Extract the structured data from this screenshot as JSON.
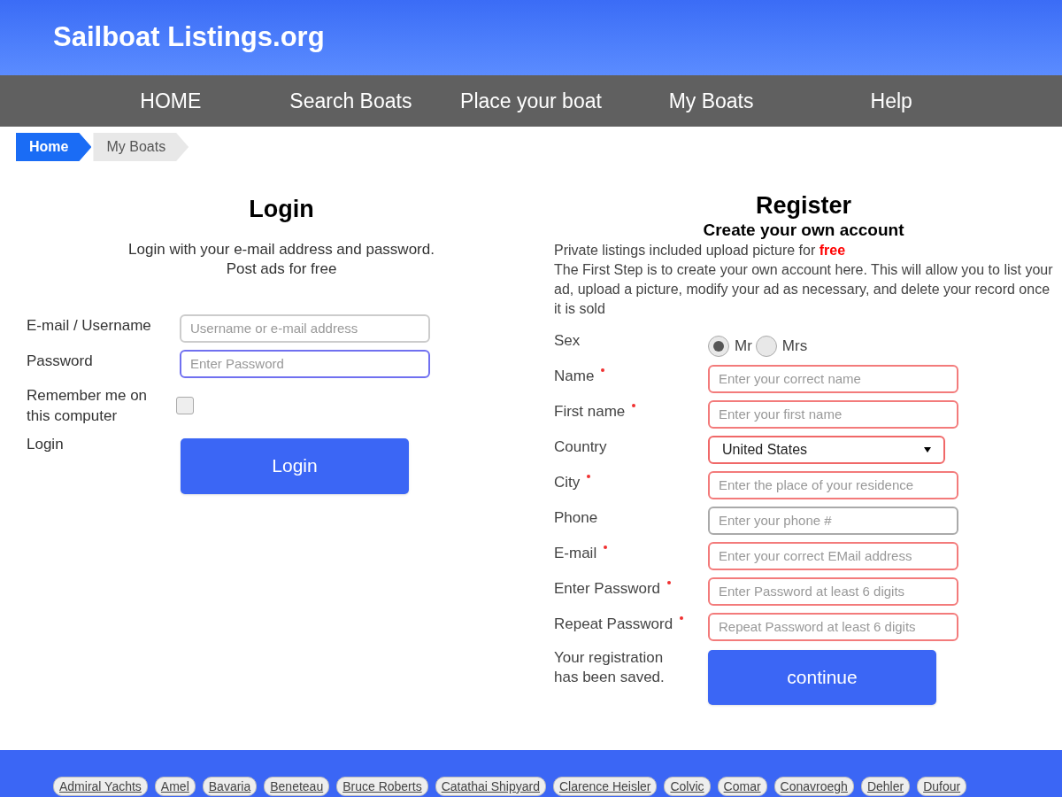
{
  "site_title": "Sailboat Listings.org",
  "nav": [
    "HOME",
    "Search Boats",
    "Place your boat",
    "My Boats",
    "Help"
  ],
  "breadcrumb": [
    {
      "label": "Home",
      "selected": true
    },
    {
      "label": "My Boats",
      "selected": false
    }
  ],
  "login": {
    "title": "Login",
    "intro": [
      "Login with your e-mail address and password.",
      "Post ads for free"
    ],
    "fields": [
      {
        "label": "E-mail / Username",
        "placeholder": "Username or e-mail address",
        "focused": false
      },
      {
        "label": "Password",
        "placeholder": "Enter Password",
        "focused": true
      }
    ],
    "remember": {
      "label": "Remember me on this computer",
      "checked": false
    },
    "submit_label": "Login",
    "button": "Login"
  },
  "register": {
    "title": "Register",
    "subtitle": "Create your own account",
    "note": "Private listings included upload picture for",
    "note_highlight": "free",
    "description": "The First Step is to create your own account here. This will allow you to list your ad, upload a picture, modify your ad as necessary, and delete your record once it is sold",
    "sex": {
      "label": "Sex",
      "options": [
        {
          "label": "Mr",
          "selected": true
        },
        {
          "label": "Mrs",
          "selected": false
        }
      ]
    },
    "fields": [
      {
        "kind": "text",
        "label": "Name",
        "required": true,
        "placeholder": "Enter your correct name"
      },
      {
        "kind": "text",
        "label": "First name",
        "required": true,
        "placeholder": "Enter your first name"
      },
      {
        "kind": "select",
        "label": "Country",
        "required": false,
        "value": "United States"
      },
      {
        "kind": "text",
        "label": "City",
        "required": true,
        "placeholder": "Enter the place of your residence"
      },
      {
        "kind": "text",
        "label": "Phone",
        "required": false,
        "placeholder": "Enter your phone #"
      },
      {
        "kind": "text",
        "label": "E-mail",
        "required": true,
        "placeholder": "Enter your correct EMail address"
      },
      {
        "kind": "text",
        "label": "Enter Password",
        "required": true,
        "placeholder": "Enter Password at least 6 digits"
      },
      {
        "kind": "text",
        "label": "Repeat Password",
        "required": true,
        "placeholder": "Repeat Password at least 6 digits"
      }
    ],
    "status": "Your registration has been saved.",
    "button": "continue"
  },
  "brands": [
    "Admiral Yachts",
    "Amel",
    "Bavaria",
    "Beneteau",
    "Bruce Roberts",
    "Catathai Shipyard",
    "Clarence Heisler",
    "Colvic",
    "Comar",
    "Conavroegh",
    "Dehler",
    "Dufour"
  ]
}
